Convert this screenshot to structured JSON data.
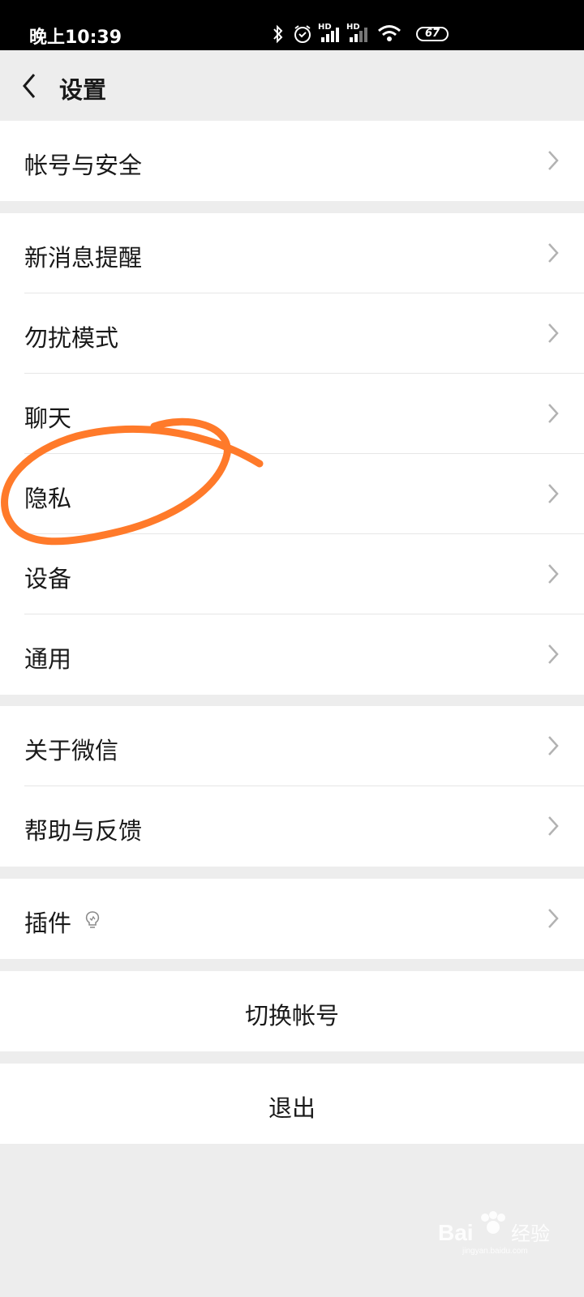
{
  "status_bar": {
    "time": "晚上10:39",
    "network_1": "HD",
    "network_2": "HD",
    "battery": "67"
  },
  "header": {
    "title": "设置",
    "back_icon": "chevron-left-icon"
  },
  "groups": [
    {
      "items": [
        {
          "label": "帐号与安全"
        }
      ]
    },
    {
      "items": [
        {
          "label": "新消息提醒"
        },
        {
          "label": "勿扰模式"
        },
        {
          "label": "聊天"
        },
        {
          "label": "隐私"
        },
        {
          "label": "设备"
        },
        {
          "label": "通用"
        }
      ]
    },
    {
      "items": [
        {
          "label": "关于微信"
        },
        {
          "label": "帮助与反馈"
        }
      ]
    },
    {
      "items": [
        {
          "label": "插件",
          "icon": "lightbulb-icon"
        }
      ]
    }
  ],
  "actions": {
    "switch_account": "切换帐号",
    "logout": "退出"
  },
  "annotation_color": "#ff7a2a",
  "watermark": "Baidu 经验",
  "watermark_url": "jingyan.baidu.com"
}
